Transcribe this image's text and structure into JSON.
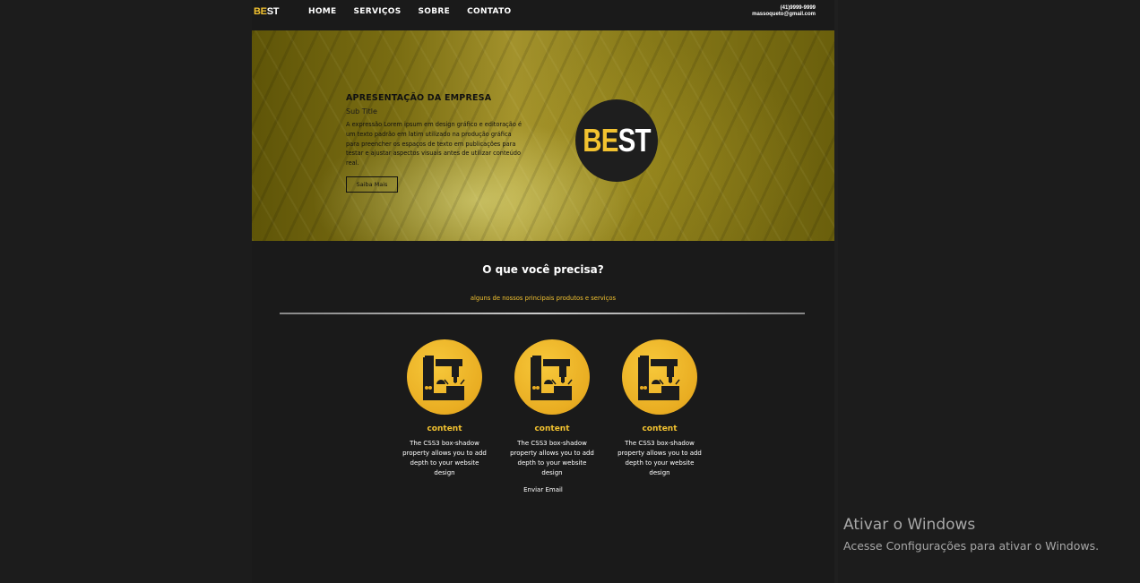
{
  "nav": {
    "logo_be": "BE",
    "logo_st": "ST",
    "items": [
      {
        "label": "HOME"
      },
      {
        "label": "SERVIÇOS"
      },
      {
        "label": "SOBRE"
      },
      {
        "label": "CONTATO"
      }
    ],
    "phone": "(41)9999-9999",
    "email": "massoqueto@gmail.com"
  },
  "hero": {
    "title": "APRESENTAÇÃO DA EMPRESA",
    "subtitle": "Sub Title",
    "paragraph": "A expressão Lorem ipsum em design gráfico e editoração é um texto padrão em latim utilizado na produção gráfica para preencher os espaços de texto em publicações para testar e ajustar aspectos visuais antes de utilizar conteúdo real.",
    "button_label": "Saiba Mais",
    "badge_be": "BE",
    "badge_st": "ST"
  },
  "services": {
    "title": "O que você precisa?",
    "subtitle": "alguns de nossos principais produtos e serviços",
    "cards": [
      {
        "title": "content",
        "text": "The CSS3 box-shadow property allows you to add depth to your website design",
        "icon": "cnc-machine-icon"
      },
      {
        "title": "content",
        "text": "The CSS3 box-shadow property allows you to add depth to your website design",
        "icon": "cnc-machine-icon"
      },
      {
        "title": "content",
        "text": "The CSS3 box-shadow property allows you to add depth to your website design",
        "icon": "cnc-machine-icon"
      }
    ],
    "email_link": "Enviar Email"
  },
  "windows_watermark": {
    "title": "Ativar o Windows",
    "subtitle": "Acesse Configurações para ativar o Windows."
  },
  "colors": {
    "accent": "#f2c230",
    "background": "#1a1a1a"
  }
}
